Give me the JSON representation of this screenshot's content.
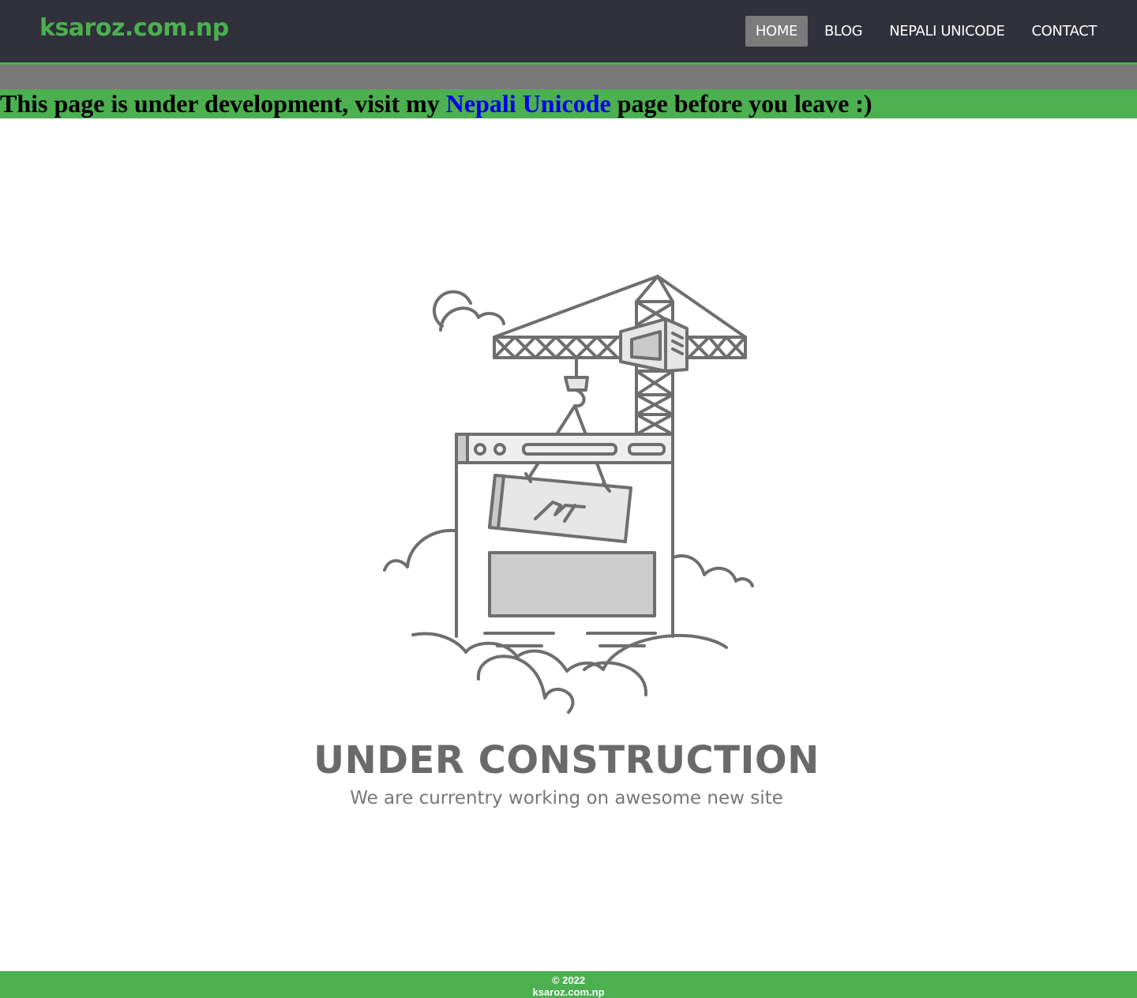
{
  "site": {
    "brand": "ksaroz.com.np",
    "brand_color": "#4caf50"
  },
  "nav": {
    "items": [
      {
        "label": "HOME",
        "active": true
      },
      {
        "label": "BLOG",
        "active": false
      },
      {
        "label": "NEPALI UNICODE",
        "active": false
      },
      {
        "label": "CONTACT",
        "active": false
      }
    ]
  },
  "notice": {
    "text_before": "This page is under development, visit my ",
    "link_text": "Nepali Unicode",
    "text_after": " page before you leave :)"
  },
  "illustration": {
    "title": "UNDER CONSTRUCTION",
    "subtitle": "We are currentry working on awesome new site",
    "logo_text": "ᏁᏁ"
  },
  "footer": {
    "copyright": "© 2022",
    "site": "ksaroz.com.np"
  },
  "colors": {
    "navbar_bg": "#30313b",
    "accent_green": "#4caf50",
    "grey_bar": "#787878",
    "link_blue": "#0000ee",
    "active_nav_bg": "#7b7b7b"
  }
}
